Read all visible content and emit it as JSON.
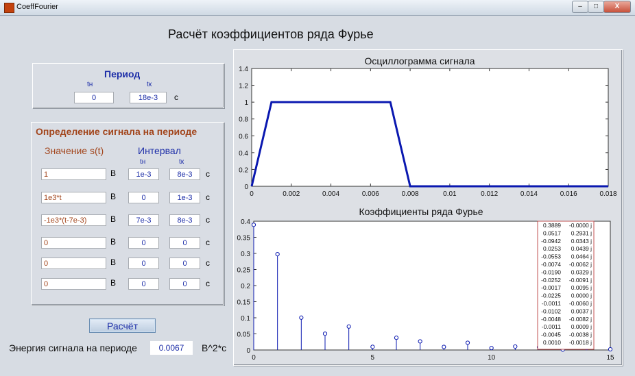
{
  "window": {
    "title": "CoeffFourier",
    "buttons": [
      "–",
      "□",
      "X"
    ]
  },
  "heading": "Расчёт коэффициентов ряда Фурье",
  "period": {
    "title": "Период",
    "tn_label": "tн",
    "tk_label": "tк",
    "tn_value": "0",
    "tk_value": "18e-3",
    "unit": "с"
  },
  "signal": {
    "title": "Определение сигнала на периоде",
    "value_header": "Значение s(t)",
    "interval_header": "Интервал",
    "tn_label": "tн",
    "tk_label": "tк",
    "value_unit": "В",
    "time_unit": "с",
    "rows": [
      {
        "value": "1",
        "tn": "1e-3",
        "tk": "8e-3"
      },
      {
        "value": "1e3*t",
        "tn": "0",
        "tk": "1e-3"
      },
      {
        "value": "-1e3*(t-7e-3)",
        "tn": "7e-3",
        "tk": "8e-3"
      },
      {
        "value": "0",
        "tn": "0",
        "tk": "0"
      },
      {
        "value": "0",
        "tn": "0",
        "tk": "0"
      },
      {
        "value": "0",
        "tn": "0",
        "tk": "0"
      }
    ]
  },
  "calc_button": "Расчёт",
  "energy": {
    "label": "Энергия сигнала на периоде",
    "value": "0.0067",
    "unit": "В^2*с"
  },
  "colors": {
    "line": "#0a18b0",
    "box_border": "#c05050",
    "label_blue": "#1d2ea8",
    "label_brown": "#a2451c"
  },
  "chart_data": [
    {
      "type": "line",
      "title": "Осциллограмма сигнала",
      "x": [
        0,
        0.001,
        0.007,
        0.008,
        0.018
      ],
      "y": [
        0,
        1,
        1,
        0,
        0
      ],
      "xlim": [
        0,
        0.018
      ],
      "ylim": [
        0,
        1.4
      ],
      "xticks": [
        "0",
        "0.002",
        "0.004",
        "0.006",
        "0.008",
        "0.01",
        "0.012",
        "0.014",
        "0.016",
        "0.018"
      ],
      "yticks": [
        "0",
        "0.2",
        "0.4",
        "0.6",
        "0.8",
        "1",
        "1.2",
        "1.4"
      ],
      "grid": false
    },
    {
      "type": "stem",
      "title": "Коэффициенты ряда Фурье",
      "x": [
        0,
        1,
        2,
        3,
        4,
        5,
        6,
        7,
        8,
        9,
        10,
        11,
        12,
        13,
        14,
        15
      ],
      "y": [
        0.3889,
        0.2976,
        0.1005,
        0.0506,
        0.0728,
        0.0099,
        0.038,
        0.0267,
        0.0095,
        0.0225,
        0.006,
        0.0107,
        0.0089,
        0.0011,
        0.006,
        0.0021
      ],
      "xlim": [
        0,
        15
      ],
      "ylim": [
        0,
        0.4
      ],
      "xticks": [
        "0",
        "5",
        "10",
        "15"
      ],
      "yticks": [
        "0",
        "0.05",
        "0.1",
        "0.15",
        "0.2",
        "0.25",
        "0.3",
        "0.35",
        "0.4"
      ],
      "grid": false,
      "coefficients_table": [
        [
          "0.3889",
          "-0.0000 j"
        ],
        [
          "0.0517",
          "0.2931 j"
        ],
        [
          "-0.0942",
          "0.0343 j"
        ],
        [
          "0.0253",
          "0.0439 j"
        ],
        [
          "-0.0553",
          "0.0464 j"
        ],
        [
          "-0.0074",
          "-0.0062 j"
        ],
        [
          "-0.0190",
          "0.0329 j"
        ],
        [
          "-0.0252",
          "-0.0091 j"
        ],
        [
          "-0.0017",
          "0.0095 j"
        ],
        [
          "-0.0225",
          "0.0000 j"
        ],
        [
          "-0.0011",
          "-0.0060 j"
        ],
        [
          "-0.0102",
          "0.0037 j"
        ],
        [
          "-0.0048",
          "-0.0082 j"
        ],
        [
          "-0.0011",
          "0.0009 j"
        ],
        [
          "-0.0045",
          "-0.0038 j"
        ],
        [
          "0.0010",
          "-0.0018 j"
        ]
      ]
    }
  ]
}
